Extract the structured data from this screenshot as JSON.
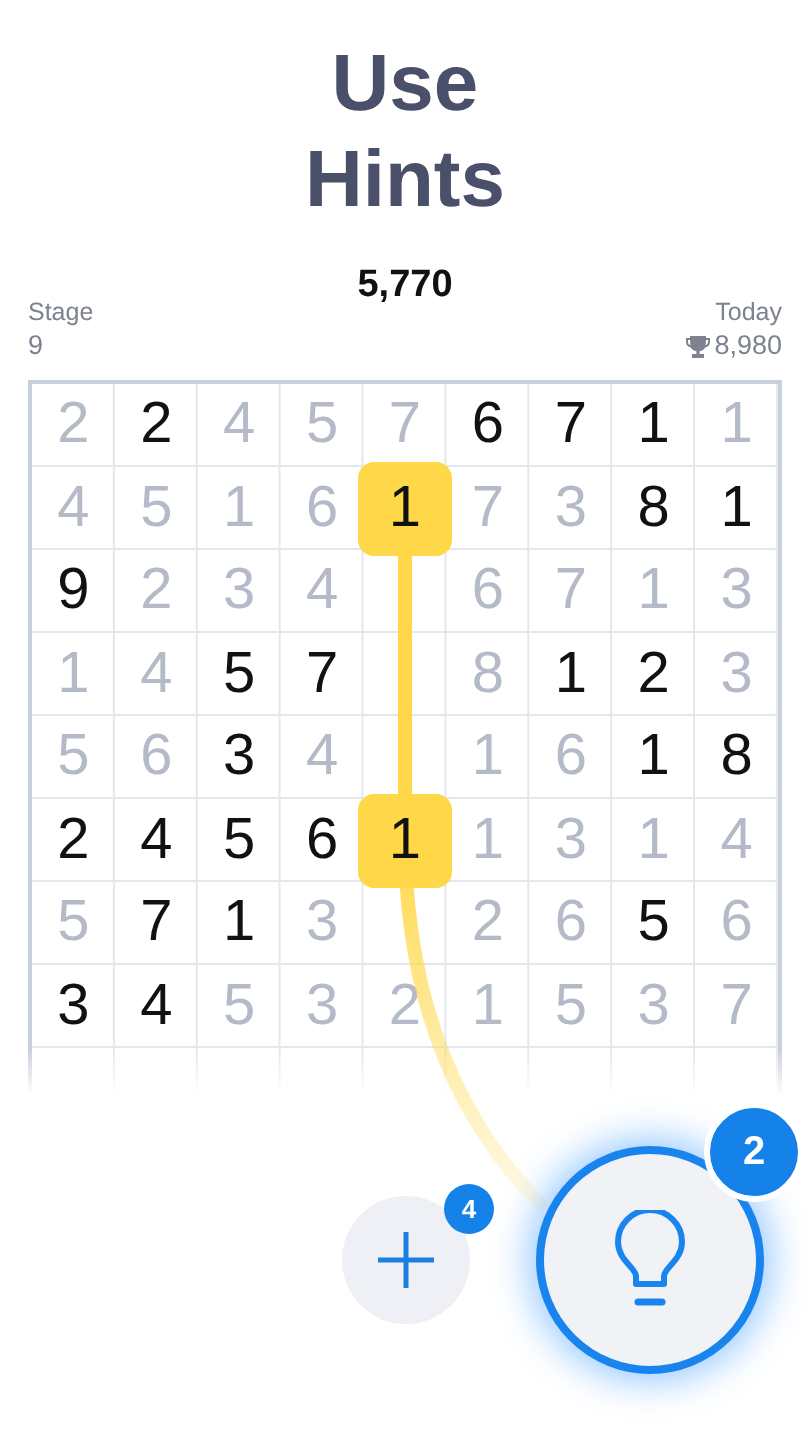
{
  "title": "Use Hints",
  "score": "5,770",
  "stage": {
    "label": "Stage",
    "value": "9"
  },
  "today": {
    "label": "Today",
    "value": "8,980"
  },
  "grid": {
    "rows": [
      [
        {
          "kind": "faded",
          "value": "2"
        },
        {
          "kind": "given",
          "value": "2"
        },
        {
          "kind": "faded",
          "value": "4"
        },
        {
          "kind": "faded",
          "value": "5"
        },
        {
          "kind": "faded",
          "value": "7"
        },
        {
          "kind": "given",
          "value": "6"
        },
        {
          "kind": "given",
          "value": "7"
        },
        {
          "kind": "given",
          "value": "1"
        },
        {
          "kind": "faded",
          "value": "1"
        }
      ],
      [
        {
          "kind": "faded",
          "value": "4"
        },
        {
          "kind": "faded",
          "value": "5"
        },
        {
          "kind": "faded",
          "value": "1"
        },
        {
          "kind": "faded",
          "value": "6"
        },
        {
          "kind": "hint",
          "value": "1"
        },
        {
          "kind": "faded",
          "value": "7"
        },
        {
          "kind": "faded",
          "value": "3"
        },
        {
          "kind": "given",
          "value": "8"
        },
        {
          "kind": "given",
          "value": "1"
        }
      ],
      [
        {
          "kind": "given",
          "value": "9"
        },
        {
          "kind": "faded",
          "value": "2"
        },
        {
          "kind": "faded",
          "value": "3"
        },
        {
          "kind": "faded",
          "value": "4"
        },
        {
          "kind": "blank"
        },
        {
          "kind": "faded",
          "value": "6"
        },
        {
          "kind": "faded",
          "value": "7"
        },
        {
          "kind": "faded",
          "value": "1"
        },
        {
          "kind": "faded",
          "value": "3"
        }
      ],
      [
        {
          "kind": "faded",
          "value": "1"
        },
        {
          "kind": "faded",
          "value": "4"
        },
        {
          "kind": "given",
          "value": "5"
        },
        {
          "kind": "given",
          "value": "7"
        },
        {
          "kind": "blank"
        },
        {
          "kind": "faded",
          "value": "8"
        },
        {
          "kind": "given",
          "value": "1"
        },
        {
          "kind": "given",
          "value": "2"
        },
        {
          "kind": "faded",
          "value": "3"
        }
      ],
      [
        {
          "kind": "faded",
          "value": "5"
        },
        {
          "kind": "faded",
          "value": "6"
        },
        {
          "kind": "given",
          "value": "3"
        },
        {
          "kind": "faded",
          "value": "4"
        },
        {
          "kind": "blank"
        },
        {
          "kind": "faded",
          "value": "1"
        },
        {
          "kind": "faded",
          "value": "6"
        },
        {
          "kind": "given",
          "value": "1"
        },
        {
          "kind": "given",
          "value": "8"
        }
      ],
      [
        {
          "kind": "given",
          "value": "2"
        },
        {
          "kind": "given",
          "value": "4"
        },
        {
          "kind": "given",
          "value": "5"
        },
        {
          "kind": "given",
          "value": "6"
        },
        {
          "kind": "hint",
          "value": "1"
        },
        {
          "kind": "faded",
          "value": "1"
        },
        {
          "kind": "faded",
          "value": "3"
        },
        {
          "kind": "faded",
          "value": "1"
        },
        {
          "kind": "faded",
          "value": "4"
        }
      ],
      [
        {
          "kind": "faded",
          "value": "5"
        },
        {
          "kind": "given",
          "value": "7"
        },
        {
          "kind": "given",
          "value": "1"
        },
        {
          "kind": "faded",
          "value": "3"
        },
        {
          "kind": "blank"
        },
        {
          "kind": "faded",
          "value": "2"
        },
        {
          "kind": "faded",
          "value": "6"
        },
        {
          "kind": "given",
          "value": "5"
        },
        {
          "kind": "faded",
          "value": "6"
        }
      ],
      [
        {
          "kind": "given",
          "value": "3"
        },
        {
          "kind": "given",
          "value": "4"
        },
        {
          "kind": "faded",
          "value": "5"
        },
        {
          "kind": "faded",
          "value": "3"
        },
        {
          "kind": "faded",
          "value": "2"
        },
        {
          "kind": "faded",
          "value": "1"
        },
        {
          "kind": "faded",
          "value": "5"
        },
        {
          "kind": "faded",
          "value": "3"
        },
        {
          "kind": "faded",
          "value": "7"
        }
      ]
    ]
  },
  "buttons": [
    {
      "kind": "add",
      "badge": "4"
    },
    {
      "kind": "hint",
      "badge": "2"
    }
  ]
}
